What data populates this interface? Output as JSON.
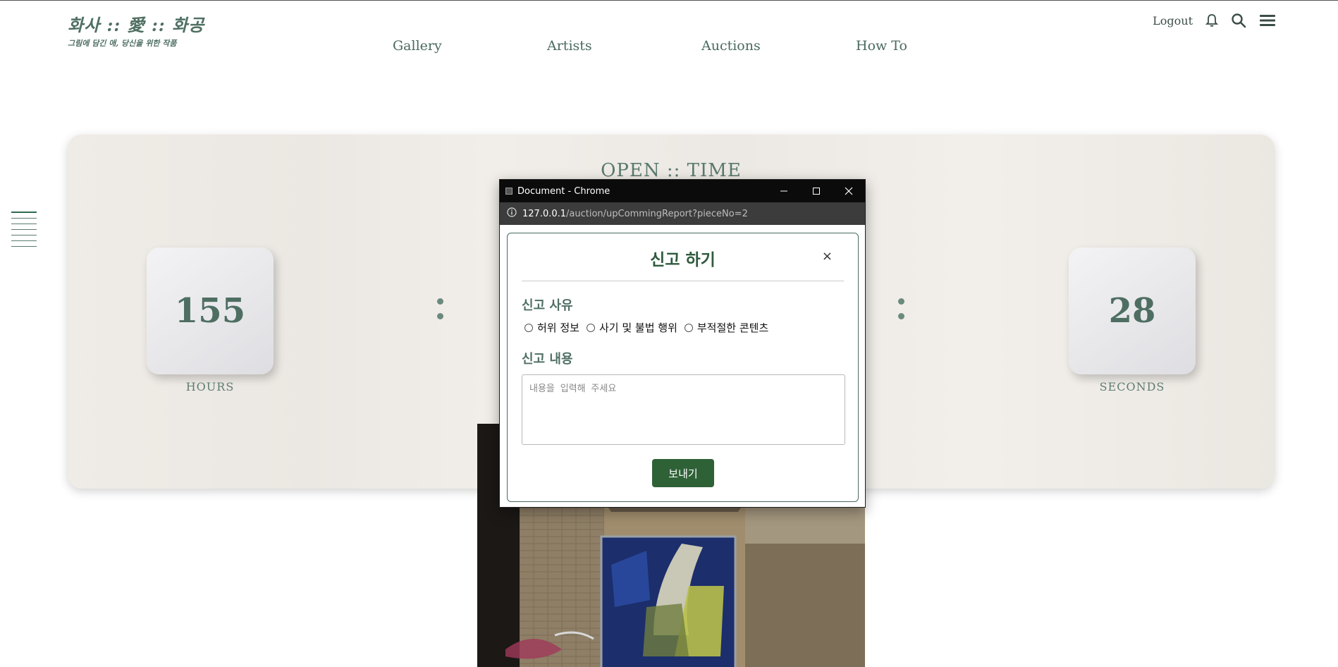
{
  "header": {
    "logo_title": "화사 :: 愛 :: 화공",
    "logo_subtitle": "그림에 담긴 애, 당신을 위한 작품",
    "nav": [
      {
        "label": "Gallery"
      },
      {
        "label": "Artists"
      },
      {
        "label": "Auctions"
      },
      {
        "label": "How To"
      }
    ],
    "logout_label": "Logout",
    "icons": [
      "bell-icon",
      "search-icon",
      "hamburger-menu-icon"
    ]
  },
  "countdown": {
    "title": "OPEN :: TIME",
    "hours_value": "155",
    "hours_label": "HOURS",
    "seconds_value": "28",
    "seconds_label": "SECONDS"
  },
  "popup": {
    "window_title": "Document - Chrome",
    "url_host": "127.0.0.1",
    "url_path": "/auction/upCommingReport?pieceNo=2",
    "modal": {
      "title": "신고 하기",
      "close_label": "×",
      "reason_label": "신고 사유",
      "reasons": [
        {
          "label": "허위 정보"
        },
        {
          "label": "사기 및 불법 행위"
        },
        {
          "label": "부적절한 콘텐츠"
        }
      ],
      "content_label": "신고 내용",
      "content_placeholder": "내용을 입력해 주세요",
      "send_label": "보내기"
    }
  },
  "colors": {
    "brand_green": "#2f6137",
    "muted_green": "#4f6f63",
    "card_bg": "#eeeae5"
  }
}
